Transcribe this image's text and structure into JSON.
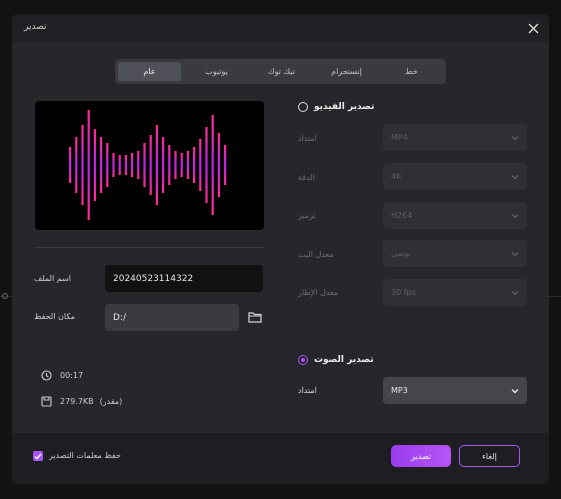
{
  "dialog": {
    "title": "تصدير"
  },
  "tabs": [
    {
      "id": "general",
      "label": "عام",
      "active": true
    },
    {
      "id": "youtube",
      "label": "يوتيوب",
      "active": false
    },
    {
      "id": "tiktok",
      "label": "تيك توك",
      "active": false
    },
    {
      "id": "instagram",
      "label": "إنستجرام",
      "active": false
    },
    {
      "id": "line",
      "label": "خط",
      "active": false
    }
  ],
  "file": {
    "name_label": "اسم الملف",
    "name_value": "20240523114322",
    "location_label": "مكان الحفظ",
    "location_value": "D:/"
  },
  "info": {
    "duration": "00:17",
    "size": "279.7KB",
    "size_note": "(مقدر)"
  },
  "video_export": {
    "label": "تصدير الفيديو",
    "selected": false,
    "options": [
      {
        "label": "امتداد",
        "value": "MP4"
      },
      {
        "label": "الدقة",
        "value": "4K"
      },
      {
        "label": "ترميز",
        "value": "H264"
      },
      {
        "label": "معدل البت",
        "value": "يوصى"
      },
      {
        "label": "معدل الإطار",
        "value": "30  fps"
      }
    ]
  },
  "audio_export": {
    "label": "تصدير الصوت",
    "selected": true,
    "format_label": "امتداد",
    "format_value": "MP3"
  },
  "footer": {
    "save_params_label": "حفظ معلمات التصدير",
    "save_params_checked": true,
    "export_label": "تصدير",
    "cancel_label": "إلغاء"
  },
  "colors": {
    "accent": "#a855f7",
    "dialog_bg": "#26262b"
  },
  "icons": [
    "close-icon",
    "folder-icon",
    "clock-icon",
    "file-size-icon",
    "chevron-down-icon",
    "checkmark-icon",
    "audio-waveform"
  ]
}
